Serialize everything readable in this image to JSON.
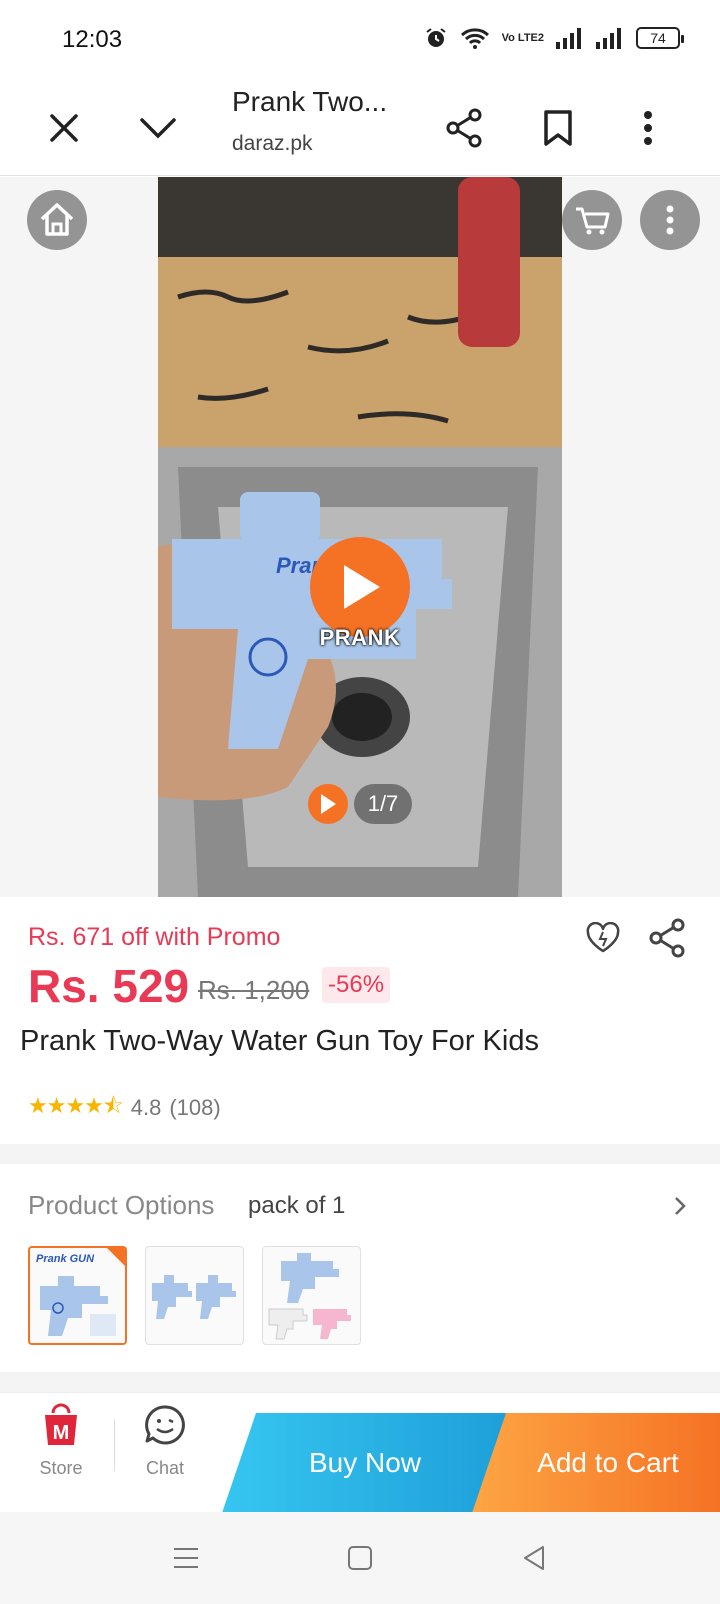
{
  "status_bar": {
    "time": "12:03",
    "volte": "Vo LTE2",
    "battery": "74",
    "icons": [
      "alarm-icon",
      "wifi-icon",
      "signal-icon",
      "signal-icon",
      "battery-icon"
    ]
  },
  "browser": {
    "title": "Prank Two...",
    "domain": "daraz.pk",
    "icons": [
      "close-icon",
      "chevron-down-icon",
      "share-icon",
      "bookmark-icon",
      "more-vert-icon"
    ]
  },
  "gallery": {
    "video_label": "PRANK",
    "counter": "1/7",
    "icons": [
      "home-icon",
      "cart-icon",
      "more-vert-icon",
      "play-icon"
    ]
  },
  "product": {
    "promo": "Rs. 671 off with Promo",
    "price": "Rs. 529",
    "original_price": "Rs. 1,200",
    "discount": "-56%",
    "title": "Prank Two-Way Water Gun Toy For Kids",
    "rating_value": "4.8",
    "rating_count": "(108)",
    "stars": 4.8
  },
  "options": {
    "label": "Product Options",
    "value": "pack of 1",
    "thumb_brand_text": "Prank GUN",
    "thumbnails": [
      "blue single pack",
      "two blue guns",
      "blue white pink set"
    ]
  },
  "actions": {
    "store_label": "Store",
    "chat_label": "Chat",
    "buy_now": "Buy Now",
    "add_to_cart": "Add to Cart"
  },
  "colors": {
    "accent_orange": "#f57224",
    "price_red": "#e83a55",
    "buy_blue": "#1e9fd9",
    "star_yellow": "#f7b500"
  }
}
